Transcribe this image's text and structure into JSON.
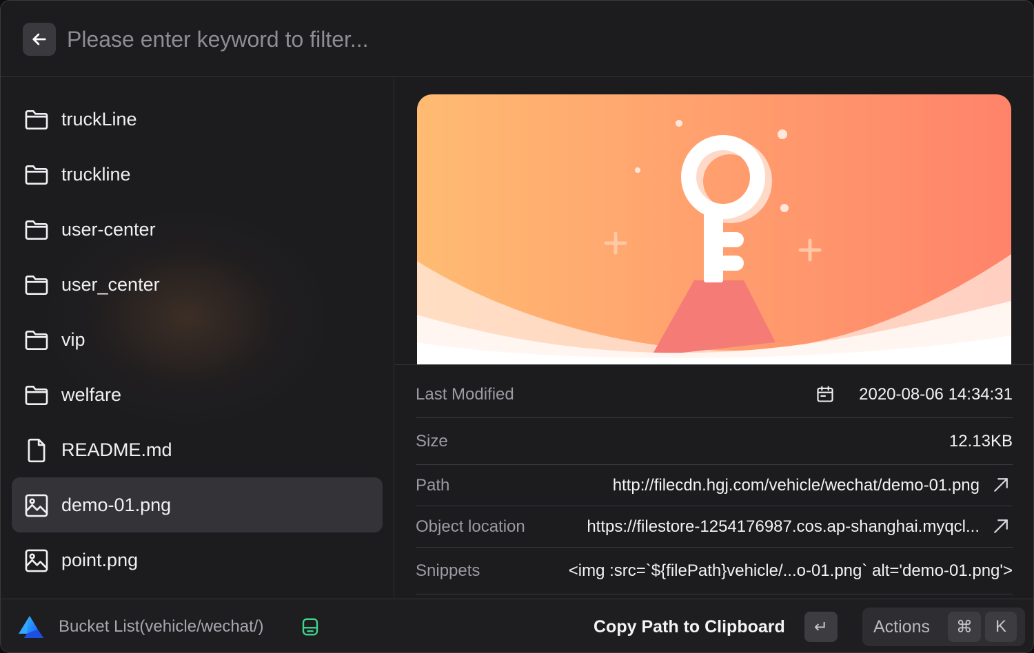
{
  "search": {
    "placeholder": "Please enter keyword to filter..."
  },
  "list": {
    "items": [
      {
        "label": "truckLine",
        "icon": "folder-icon"
      },
      {
        "label": "truckline",
        "icon": "folder-icon"
      },
      {
        "label": "user-center",
        "icon": "folder-icon"
      },
      {
        "label": "user_center",
        "icon": "folder-icon"
      },
      {
        "label": "vip",
        "icon": "folder-icon"
      },
      {
        "label": "welfare",
        "icon": "folder-icon"
      },
      {
        "label": "README.md",
        "icon": "file-icon"
      },
      {
        "label": "demo-01.png",
        "icon": "image-icon",
        "selected": true
      },
      {
        "label": "point.png",
        "icon": "image-icon"
      }
    ]
  },
  "details": {
    "last_modified": {
      "key": "Last Modified",
      "value": "2020-08-06 14:34:31"
    },
    "size": {
      "key": "Size",
      "value": "12.13KB"
    },
    "path": {
      "key": "Path",
      "value": "http://filecdn.hgj.com/vehicle/wechat/demo-01.png"
    },
    "object_location": {
      "key": "Object location",
      "value": "https://filestore-1254176987.cos.ap-shanghai.myqcl..."
    },
    "snippets": {
      "key": "Snippets",
      "value": "<img :src=`${filePath}vehicle/...o-01.png` alt='demo-01.png'>"
    }
  },
  "footer": {
    "title": "Bucket List(vehicle/wechat/)",
    "primary_action": "Copy Path to Clipboard",
    "enter_key": "↵",
    "actions_label": "Actions",
    "cmd_key": "⌘",
    "k_key": "K"
  },
  "colors": {
    "selected_bg": "#343438",
    "accent_green": "#3ed68a",
    "gradient_start": "#ffb970",
    "gradient_end": "#ff8468"
  }
}
